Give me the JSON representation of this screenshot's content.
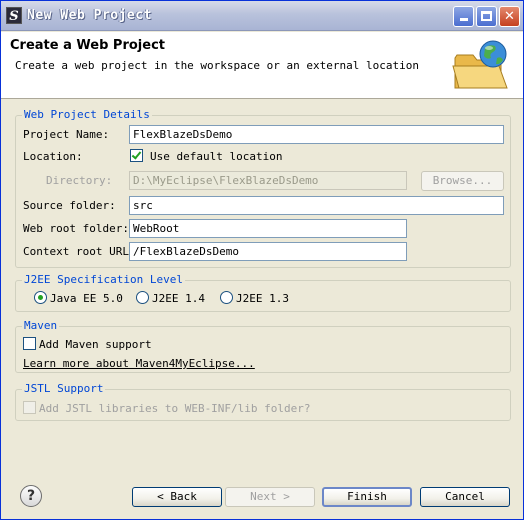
{
  "window": {
    "title": "New Web Project",
    "app_icon": "S"
  },
  "banner": {
    "title": "Create a Web Project",
    "description": "Create a web project in the workspace or an external location",
    "icon": "folder-globe-icon"
  },
  "details": {
    "legend": "Web Project Details",
    "project_name_label": "Project Name:",
    "project_name_value": "FlexBlazeDsDemo",
    "location_label": "Location:",
    "use_default_label": "Use default location",
    "use_default_checked": true,
    "directory_label": "Directory:",
    "directory_value": "D:\\MyEclipse\\FlexBlazeDsDemo",
    "browse_label": "Browse...",
    "source_folder_label": "Source folder:",
    "source_folder_value": "src",
    "web_root_label": "Web root folder:",
    "web_root_value": "WebRoot",
    "context_root_label": "Context root URL:",
    "context_root_value": "/FlexBlazeDsDemo"
  },
  "j2ee": {
    "legend": "J2EE Specification Level",
    "options": [
      "Java EE 5.0",
      "J2EE 1.4",
      "J2EE 1.3"
    ],
    "selected": "Java EE 5.0"
  },
  "maven": {
    "legend": "Maven",
    "add_support_label": "Add Maven support",
    "add_support_checked": false,
    "learn_more_link": "Learn more about Maven4MyEclipse..."
  },
  "jstl": {
    "legend": "JSTL Support",
    "add_jstl_label": "Add JSTL libraries to WEB-INF/lib folder?",
    "add_jstl_checked": false
  },
  "footer": {
    "help_label": "?",
    "back_label": "< Back",
    "next_label": "Next >",
    "finish_label": "Finish",
    "cancel_label": "Cancel"
  }
}
